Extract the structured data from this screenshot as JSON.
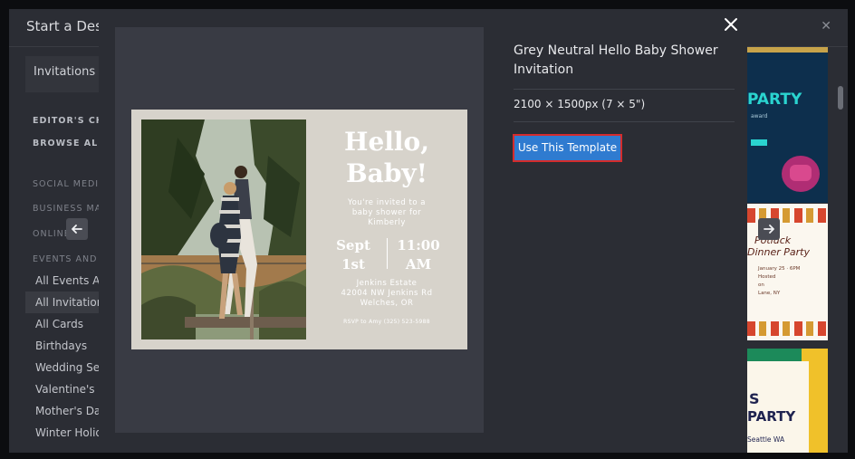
{
  "background_dialog": {
    "title": "Start a Desig",
    "sidebar": {
      "top_label": "Invitations",
      "categories": [
        "EDITOR'S CHOI",
        "BROWSE ALL T",
        "SOCIAL MEDIA",
        "BUSINESS MAR",
        "ONLINE",
        "EVENTS AND C"
      ],
      "subitems": [
        "All Events Ar",
        "All Invitation",
        "All Cards",
        "Birthdays",
        "Wedding Set",
        "Valentine's D",
        "Mother's Day",
        "Winter Holid"
      ],
      "active_index": 1
    },
    "thumbnails": {
      "t1": {
        "title": "PARTY",
        "small": "award"
      },
      "t2": {
        "line1": "Potluck",
        "line2": "Dinner Party",
        "info": [
          "January 25 · 6PM",
          "",
          "Hosted",
          "on",
          "Lane, NY"
        ]
      },
      "t3": {
        "letter": "S",
        "title": "PARTY",
        "location": "Seattle WA"
      }
    }
  },
  "modal": {
    "title": "Grey Neutral Hello Baby Shower Invitation",
    "size": "2100 × 1500px (7 × 5\")",
    "use_button_label": "Use This Template",
    "card": {
      "headline": "Hello,\nBaby!",
      "invite": "You're invited to a\nbaby shower for\nKimberly",
      "date": "Sept\n1st",
      "time": "11:00\nAM",
      "address": "Jenkins Estate\n42004 NW Jenkins Rd\nWelches, OR",
      "rsvp": "RSVP to Amy (325) 523-5988"
    }
  },
  "colors": {
    "accent": "#2f7bd0",
    "highlight": "#d52c2c",
    "modal_bg": "#2b2d34",
    "card_bg": "#d7d3cb"
  },
  "icons": {
    "close": "close-icon",
    "prev": "arrow-left-icon",
    "next": "arrow-right-icon"
  }
}
